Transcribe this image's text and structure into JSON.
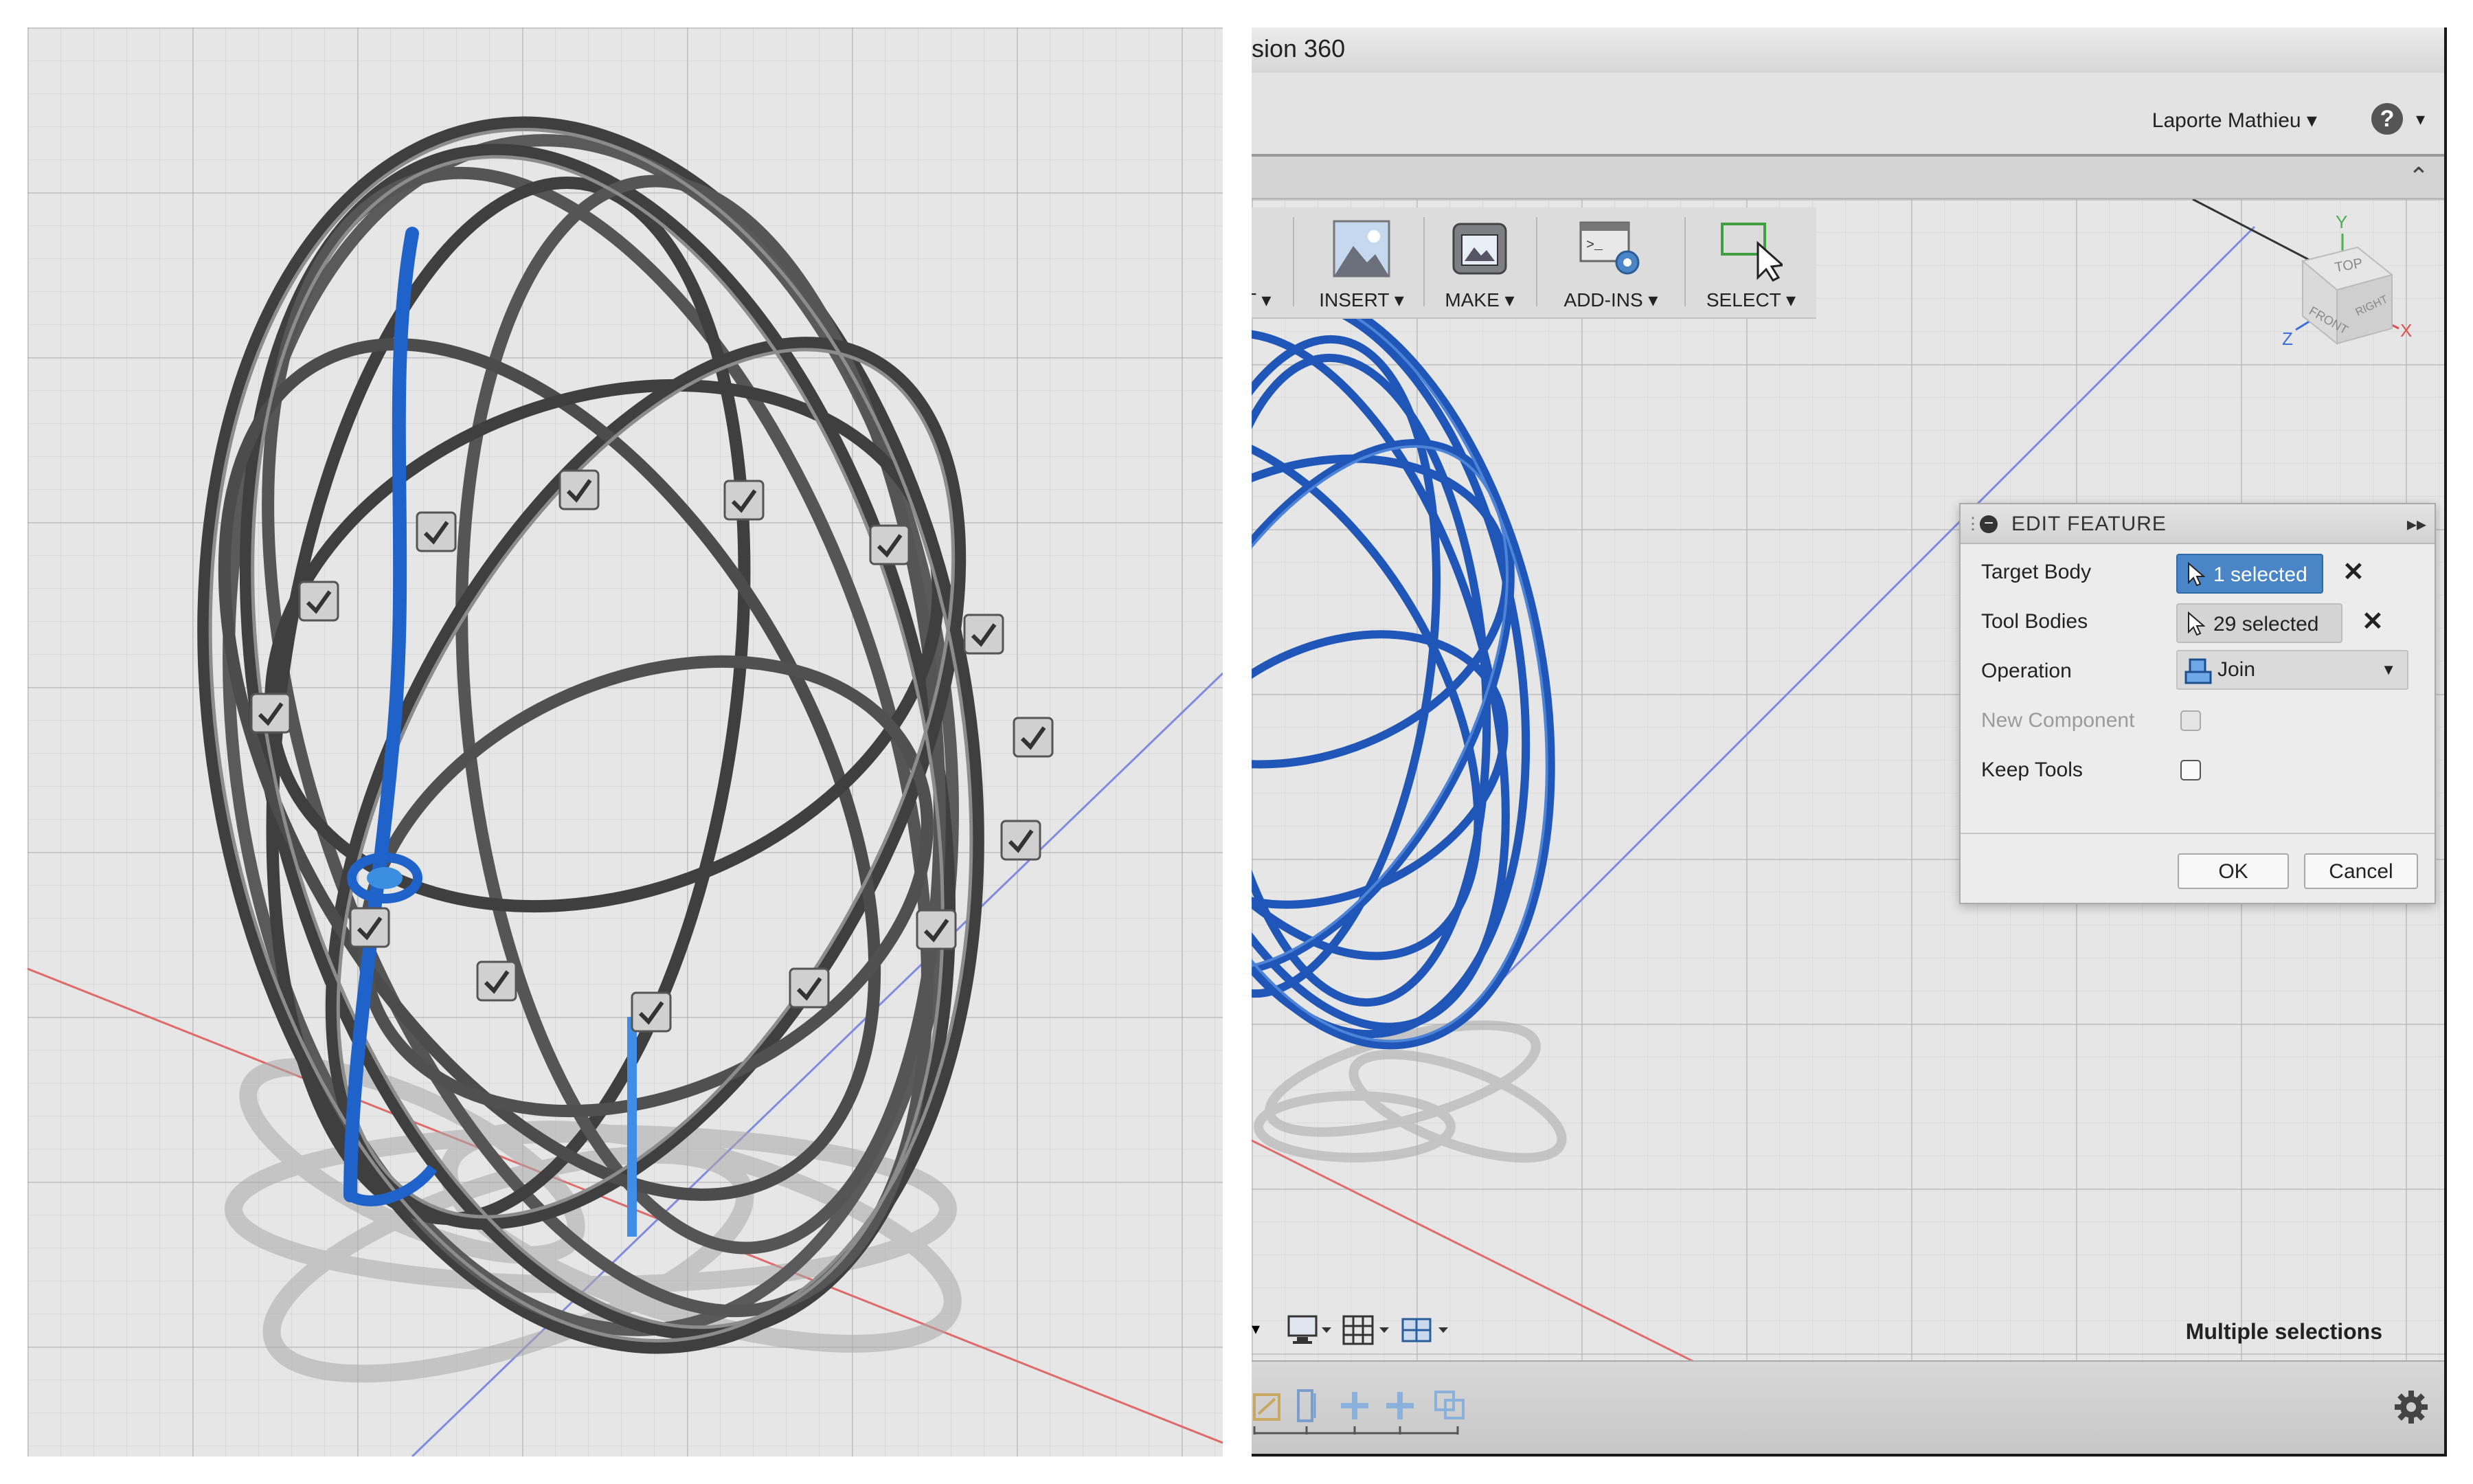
{
  "window": {
    "title": "sion 360"
  },
  "account": {
    "user_name": "Laporte Mathieu ▾",
    "help_label": "?"
  },
  "toolbar": {
    "partial_label": "T ▾",
    "insert_label": "INSERT ▾",
    "make_label": "MAKE ▾",
    "addins_label": "ADD-INS ▾",
    "select_label": "SELECT ▾"
  },
  "viewcube": {
    "top": "TOP",
    "front": "FRONT",
    "right": "RIGHT",
    "axis_x": "X",
    "axis_y": "Y",
    "axis_z": "Z"
  },
  "dialog": {
    "title": "EDIT FEATURE",
    "target_body_label": "Target Body",
    "target_body_value": "1 selected",
    "tool_bodies_label": "Tool Bodies",
    "tool_bodies_value": "29 selected",
    "operation_label": "Operation",
    "operation_value": "Join",
    "new_component_label": "New Component",
    "keep_tools_label": "Keep Tools",
    "ok_label": "OK",
    "cancel_label": "Cancel"
  },
  "status": {
    "text": "Multiple selections"
  },
  "colors": {
    "accent_blue": "#4a86c7",
    "body_blue": "#1f56b8",
    "tube_gray": "#4a4a4a",
    "axis_red": "#e05a5a",
    "axis_blue": "#6f7fe0"
  }
}
